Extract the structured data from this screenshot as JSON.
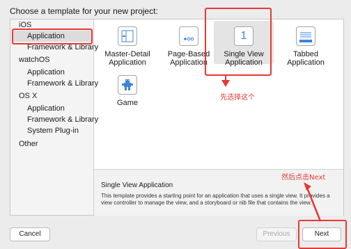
{
  "dialog": {
    "heading": "Choose a template for your new project:"
  },
  "sidebar": {
    "groups": [
      {
        "label": "iOS",
        "items": [
          "Application",
          "Framework & Library"
        ]
      },
      {
        "label": "watchOS",
        "items": [
          "Application",
          "Framework & Library"
        ]
      },
      {
        "label": "OS X",
        "items": [
          "Application",
          "Framework & Library",
          "System Plug-in"
        ]
      },
      {
        "label": "Other",
        "items": []
      }
    ],
    "selected": "iOS / Application"
  },
  "templates": [
    {
      "line1": "Master-Detail",
      "line2": "Application",
      "icon": "master-detail-icon"
    },
    {
      "line1": "Page-Based",
      "line2": "Application",
      "icon": "page-based-icon"
    },
    {
      "line1": "Single View",
      "line2": "Application",
      "icon": "single-view-icon",
      "icon_glyph": "1",
      "selected": true
    },
    {
      "line1": "Tabbed",
      "line2": "Application",
      "icon": "tabbed-icon"
    },
    {
      "line1": "Game",
      "line2": "",
      "icon": "game-icon"
    }
  ],
  "description": {
    "title": "Single View Application",
    "body": "This template provides a starting point for an application that uses a single view. It provides a view controller to manage the view, and a storyboard or nib file that contains the view."
  },
  "buttons": {
    "cancel": "Cancel",
    "previous": "Previous",
    "next": "Next"
  },
  "annotations": {
    "step1": "先选择这个",
    "step2": "然后点击Next",
    "color": "#e53935"
  }
}
